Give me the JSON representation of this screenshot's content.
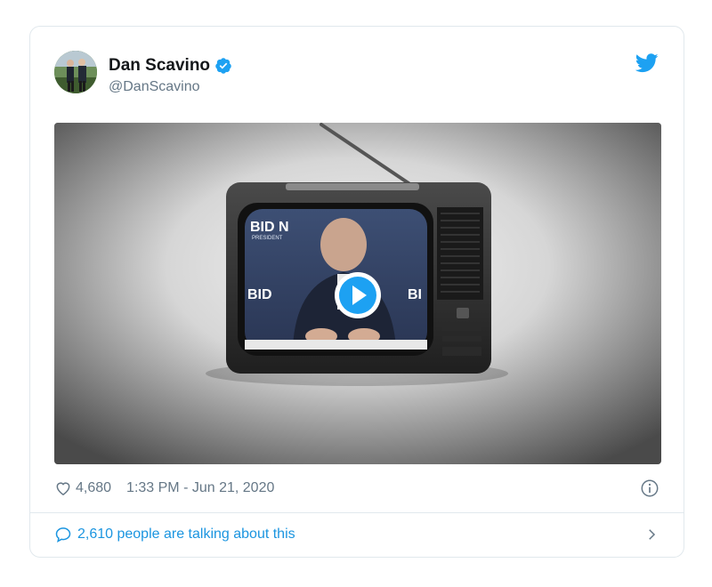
{
  "user": {
    "display_name": "Dan Scavino",
    "handle": "@DanScavino",
    "verified": true
  },
  "media": {
    "type": "video",
    "tv_banner_top": "BID N",
    "tv_banner_top_sub": "PRESIDENT",
    "tv_banner_left": "BID",
    "tv_banner_right": "BI",
    "play_icon": "play-icon"
  },
  "stats": {
    "likes": "4,680",
    "timestamp": "1:33 PM - Jun 21, 2020"
  },
  "footer": {
    "talking_text": "2,610 people are talking about this"
  },
  "colors": {
    "brand_blue": "#1da1f2",
    "link_blue": "#1b95e0",
    "muted": "#657786",
    "border": "#e1e8ed"
  }
}
